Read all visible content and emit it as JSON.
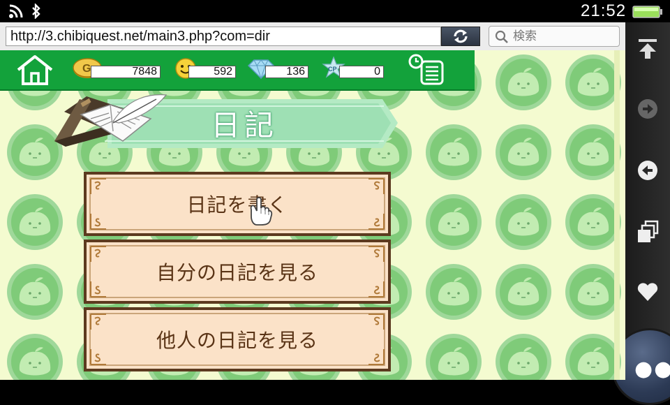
{
  "status_bar": {
    "clock": "21:52",
    "icons": [
      "wifi-icon",
      "bluetooth-icon",
      "battery-icon"
    ]
  },
  "browser": {
    "url": "http://3.chibiquest.net/main3.php?com=dir",
    "search_placeholder": "検索"
  },
  "hud": {
    "gold": "7848",
    "smile": "592",
    "diamond": "136",
    "cp": "0",
    "cp_badge": "CP",
    "gold_badge": "G"
  },
  "page": {
    "title": "日記",
    "menu": [
      {
        "label": "日記を書く"
      },
      {
        "label": "自分の日記を見る"
      },
      {
        "label": "他人の日記を見る"
      }
    ]
  },
  "colors": {
    "hud_green": "#13a23b",
    "background": "#f4fbd0",
    "button_fill": "#fbe2c8",
    "button_border": "#5c3a1f"
  }
}
